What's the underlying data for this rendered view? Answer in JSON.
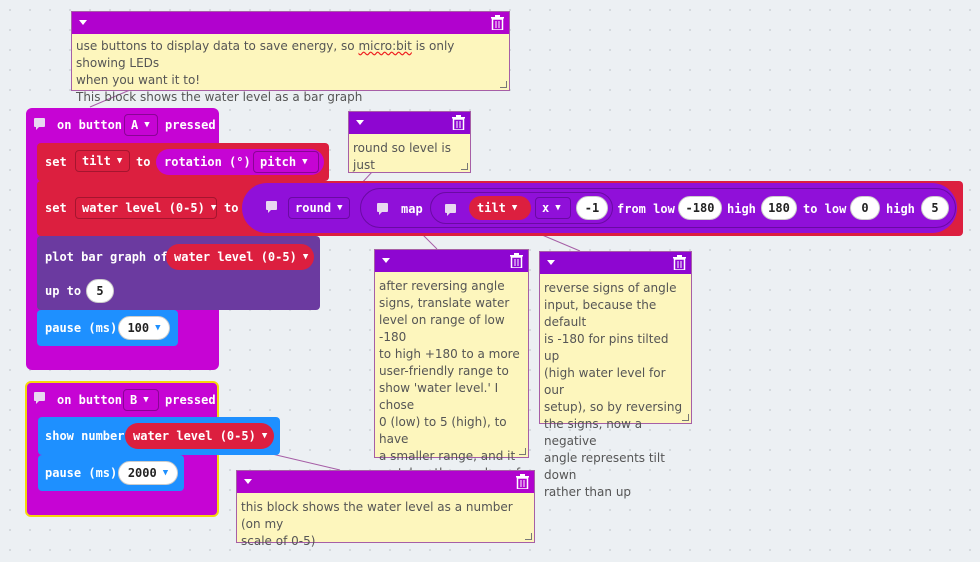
{
  "colors": {
    "event": "#c604d4",
    "variables": "#dc1f3f",
    "led": "#6b3aa0",
    "basic": "#1e90ff",
    "math": "#9010d9",
    "note": "#fdf6bd"
  },
  "notes": {
    "top": {
      "line1_pre": "use buttons to display data to save energy, so ",
      "line1_link": "micro:bit",
      "line1_post": " is only showing LEDs",
      "line2": "when you want it to!",
      "line3": "This block shows the water level as a bar graph"
    },
    "round": {
      "text": "round so level is just\nintegers"
    },
    "reverse": {
      "text": "after reversing angle\nsigns, translate water\nlevel on range of low -180\nto high +180 to a more\nuser-friendly range to\nshow 'water level.' I chose\n0 (low) to 5 (high), to have\na smaller range, and it\nmatches the number of\nLED rows on the display."
    },
    "signs": {
      "text": "reverse signs of angle\ninput, because the default\nis -180 for pins tilted up\n(high water level for our\nsetup), so by reversing\nthe signs, now a negative\nangle represents tilt down\nrather than up"
    },
    "number": {
      "text": "this block shows the water level as a number (on my\nscale of 0-5)"
    }
  },
  "blockA": {
    "on": "on button",
    "button": "A",
    "pressed": "pressed",
    "set1": {
      "set": "set",
      "var": "tilt",
      "to": "to",
      "rotation": "rotation (°)",
      "axis": "pitch"
    },
    "set2": {
      "set": "set",
      "var": "water level (0-5)",
      "to": "to",
      "round": "round",
      "map": "map",
      "tilt": "tilt",
      "op": "x",
      "factor": "-1",
      "from_low": "from low",
      "v_from_low": "-180",
      "high1": "high",
      "v_high1": "180",
      "to_low": "to low",
      "v_to_low": "0",
      "high2": "high",
      "v_high2": "5"
    },
    "plot": {
      "label": "plot bar graph of",
      "var": "water level (0-5)",
      "upto": "up to",
      "v_upto": "5"
    },
    "pause": {
      "label": "pause (ms)",
      "value": "100"
    }
  },
  "blockB": {
    "on": "on button",
    "button": "B",
    "pressed": "pressed",
    "show": {
      "label": "show number",
      "var": "water level (0-5)"
    },
    "pause": {
      "label": "pause (ms)",
      "value": "2000"
    }
  }
}
